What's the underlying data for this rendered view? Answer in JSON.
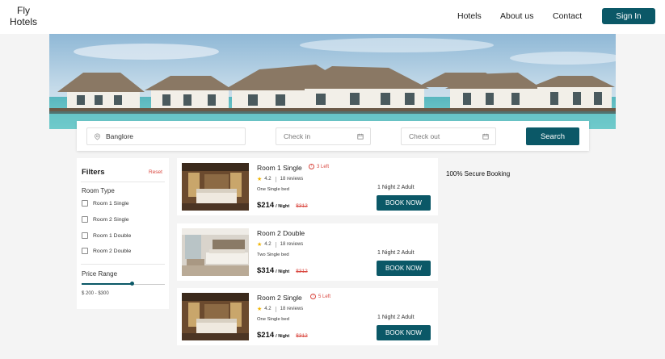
{
  "header": {
    "logo_line1": "Fly",
    "logo_line2": "Hotels",
    "nav": [
      "Hotels",
      "About us",
      "Contact"
    ],
    "signin_label": "Sign In"
  },
  "search": {
    "location_value": "Banglore",
    "checkin_placeholder": "Check in",
    "checkout_placeholder": "Check out",
    "search_label": "Search"
  },
  "filters": {
    "title": "Filters",
    "reset_label": "Reset",
    "room_type_title": "Room Type",
    "room_types": [
      "Room 1 Single",
      "Room 2 Single",
      "Room 1 Double",
      "Room 2 Double"
    ],
    "price_range_title": "Price Range",
    "price_range_text": "$ 200 - $300",
    "slider_level": 0.6
  },
  "rooms": [
    {
      "name": "Room 1 Single",
      "left_text": "3 Left",
      "rating": "4.2",
      "reviews": "18 reviews",
      "bed": "One Single bed",
      "price": "$214",
      "per_night": "/ Night",
      "old_price": "$312",
      "guests": "1 Night 2 Adult",
      "book_label": "BOOK NOW"
    },
    {
      "name": "Room 2 Double",
      "left_text": "",
      "rating": "4.2",
      "reviews": "18 reviews",
      "bed": "Two Single bed",
      "price": "$314",
      "per_night": "/ Night",
      "old_price": "$312",
      "guests": "1 Night 2 Adult",
      "book_label": "BOOK NOW"
    },
    {
      "name": "Room 2 Single",
      "left_text": "5 Left",
      "rating": "4.2",
      "reviews": "18 reviews",
      "bed": "One Single bed",
      "price": "$214",
      "per_night": "/ Night",
      "old_price": "$312",
      "guests": "1 Night 2 Adult",
      "book_label": "BOOK NOW"
    }
  ],
  "secure_text": "100% Secure Booking",
  "colors": {
    "accent": "#0b5867",
    "alert": "#d9463e",
    "star": "#f1b400"
  }
}
